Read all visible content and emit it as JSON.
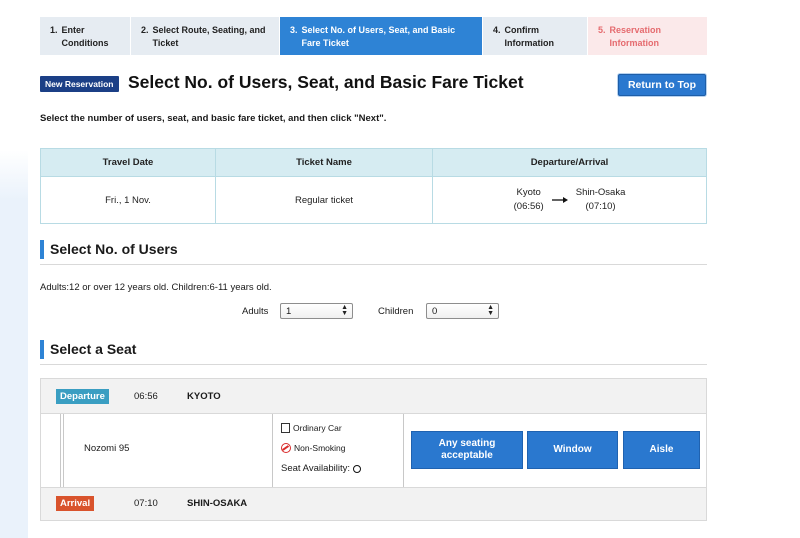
{
  "steps": [
    {
      "num": "1.",
      "label": "Enter Conditions",
      "state": "done"
    },
    {
      "num": "2.",
      "label": "Select Route, Seating, and Ticket",
      "state": "done"
    },
    {
      "num": "3.",
      "label": "Select No. of Users, Seat, and Basic Fare Ticket",
      "state": "active"
    },
    {
      "num": "4.",
      "label": "Confirm Information",
      "state": "done"
    },
    {
      "num": "5.",
      "label": "Reservation Information",
      "state": "pending"
    }
  ],
  "header": {
    "badge": "New Reservation",
    "title": "Select No. of Users, Seat, and Basic Fare Ticket",
    "return_label": "Return to Top"
  },
  "instruction": "Select the number of users, seat, and basic fare ticket, and then click \"Next\".",
  "travel": {
    "headers": [
      "Travel Date",
      "Ticket Name",
      "Departure/Arrival"
    ],
    "date": "Fri., 1 Nov.",
    "ticket": "Regular ticket",
    "from_station": "Kyoto",
    "from_time": "(06:56)",
    "to_station": "Shin-Osaka",
    "to_time": "(07:10)"
  },
  "users": {
    "heading": "Select No. of Users",
    "note": "Adults:12 or over 12 years old. Children:6-11 years old.",
    "adults_label": "Adults",
    "adults_value": "1",
    "children_label": "Children",
    "children_value": "0"
  },
  "seat": {
    "heading": "Select a Seat",
    "departure_tag": "Departure",
    "departure_time": "06:56",
    "departure_station": "KYOTO",
    "train": "Nozomi 95",
    "car_type": "Ordinary Car",
    "smoking": "Non-Smoking",
    "availability_label": "Seat Availability:",
    "buttons": [
      "Any seating acceptable",
      "Window",
      "Aisle"
    ],
    "arrival_tag": "Arrival",
    "arrival_time": "07:10",
    "arrival_station": "SHIN-OSAKA"
  },
  "colors": {
    "accent": "#2e83d5",
    "navy": "#1b3f86",
    "pending": "#e56b6f",
    "departure": "#3a9ec2",
    "arrival": "#d9532c"
  }
}
